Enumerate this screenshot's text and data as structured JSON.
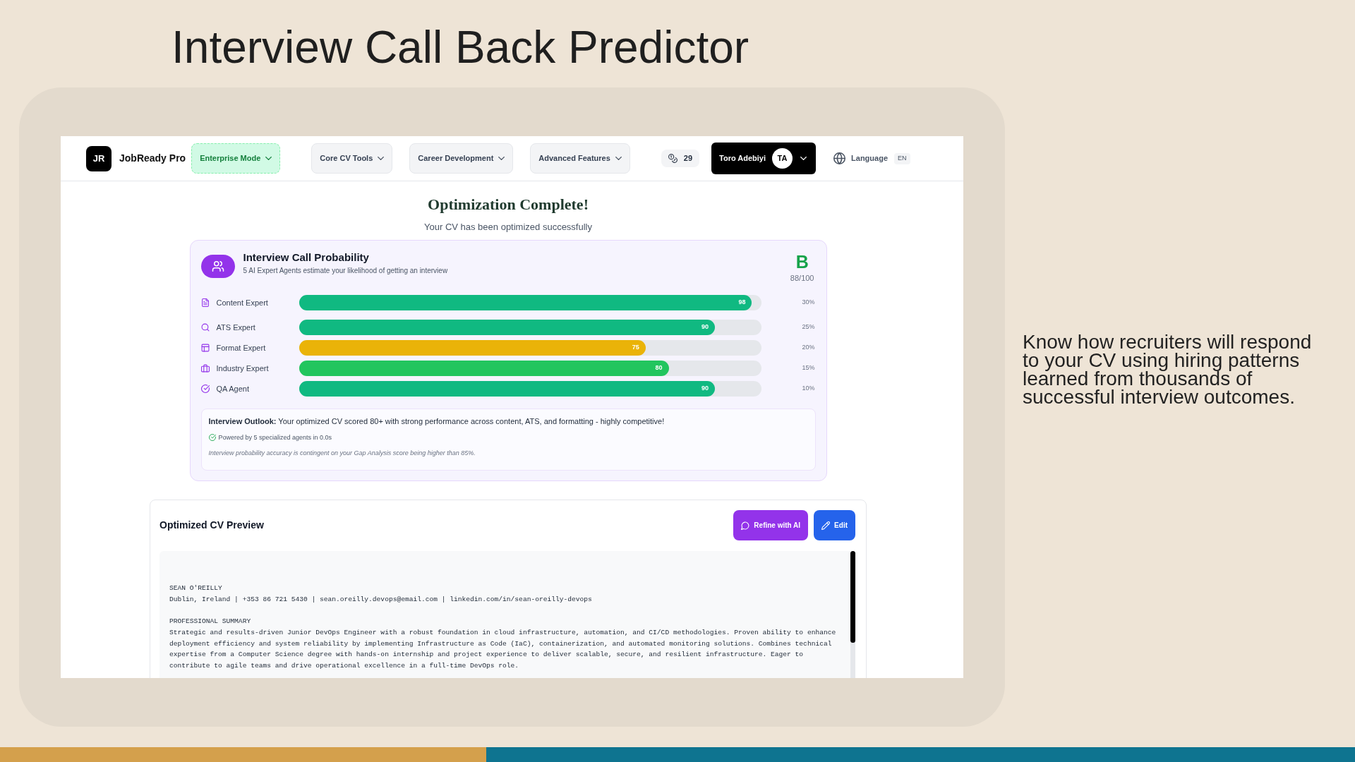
{
  "slide": {
    "title": "Interview Call Back Predictor",
    "description": "Know how recruiters will respond to your CV using hiring patterns learned from thousands of successful interview outcomes."
  },
  "navbar": {
    "logo": "JR",
    "brand": "JobReady Pro",
    "menus": [
      {
        "label": "Enterprise Mode",
        "kind": "highlight"
      },
      {
        "label": "Core CV Tools",
        "kind": "default"
      },
      {
        "label": "Career Development",
        "kind": "default"
      },
      {
        "label": "Advanced Features",
        "kind": "default"
      }
    ],
    "credits": "29",
    "user": {
      "name": "Toro Adebiyi",
      "initials": "TA"
    },
    "language": {
      "label": "Language",
      "code": "EN"
    }
  },
  "result": {
    "title": "Optimization Complete!",
    "subtitle": "Your CV has been optimized successfully"
  },
  "probability_card": {
    "title": "Interview Call Probability",
    "subtitle": "5 AI Expert Agents estimate your likelihood of getting an interview",
    "grade": "B",
    "score": "88/100",
    "agents": [
      {
        "name": "Content Expert",
        "score": "98",
        "level": 0.98,
        "weight": "30%",
        "color": "#10b981"
      },
      {
        "name": "ATS Expert",
        "score": "90",
        "level": 0.9,
        "weight": "25%",
        "color": "#10b981"
      },
      {
        "name": "Format Expert",
        "score": "75",
        "level": 0.75,
        "weight": "20%",
        "color": "#eab308"
      },
      {
        "name": "Industry Expert",
        "score": "80",
        "level": 0.8,
        "weight": "15%",
        "color": "#22c55e"
      },
      {
        "name": "QA Agent",
        "score": "90",
        "level": 0.9,
        "weight": "10%",
        "color": "#10b981"
      }
    ],
    "outlook": {
      "text": "**Interview Outlook:** Your optimized CV scored 80+ with strong performance across content, ATS, and formatting - highly competitive!",
      "powered_by": "Powered by 5 specialized agents in 0.0s",
      "disclaimer": "Interview probability accuracy is contingent on your Gap Analysis score being higher than 85%."
    }
  },
  "cv_preview": {
    "title": "Optimized CV Preview",
    "buttons": [
      {
        "label": "Refine with AI",
        "kind": "refine"
      },
      {
        "label": "Edit",
        "kind": "edit"
      }
    ],
    "blocks": [
      [
        "SEAN O'REILLY",
        "Dublin, Ireland | +353 86 721 5430 | sean.oreilly.devops@email.com | linkedin.com/in/sean-oreilly-devops"
      ],
      [
        "PROFESSIONAL SUMMARY",
        "Strategic and results-driven Junior DevOps Engineer with a robust foundation in cloud infrastructure, automation, and CI/CD methodologies. Proven ability to enhance deployment efficiency and system reliability by implementing Infrastructure as Code (IaC), containerization, and automated monitoring solutions. Combines technical expertise from a Computer Science degree with hands-on internship and project experience to deliver scalable, secure, and resilient infrastructure. Eager to contribute to agile teams and drive operational excellence in a full-time DevOps role."
      ]
    ]
  }
}
